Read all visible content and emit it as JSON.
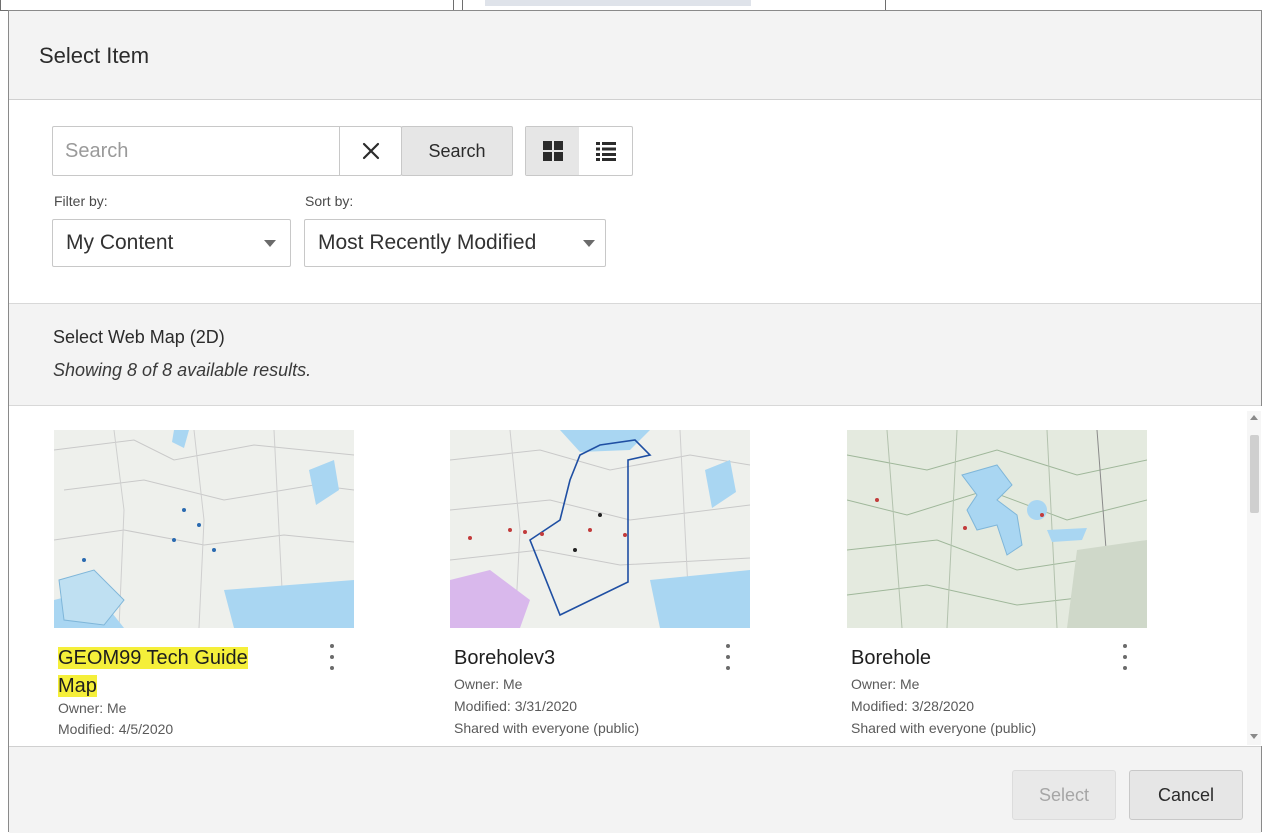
{
  "dialog": {
    "title": "Select Item"
  },
  "toolbar": {
    "search_placeholder": "Search",
    "search_value": "",
    "search_button": "Search",
    "view_mode": "grid"
  },
  "filters": {
    "filter_label": "Filter by:",
    "filter_value": "My Content",
    "sort_label": "Sort by:",
    "sort_value": "Most Recently Modified"
  },
  "section": {
    "title": "Select Web Map (2D)",
    "subtitle": "Showing 8 of 8 available results."
  },
  "items": [
    {
      "title_line1": "GEOM99 Tech Guide",
      "title_line2": "Map",
      "owner": "Owner: Me",
      "modified": "Modified: 4/5/2020",
      "shared": ""
    },
    {
      "title_line1": "Boreholev3",
      "title_line2": "",
      "owner": "Owner: Me",
      "modified": "Modified: 3/31/2020",
      "shared": "Shared with everyone (public)"
    },
    {
      "title_line1": "Borehole",
      "title_line2": "",
      "owner": "Owner: Me",
      "modified": "Modified: 3/28/2020",
      "shared": "Shared with everyone (public)"
    }
  ],
  "footer": {
    "select_label": "Select",
    "cancel_label": "Cancel"
  },
  "colors": {
    "highlight": "#f5ef3a",
    "header_bg": "#f3f3f3",
    "water": "#a9d6f2",
    "boundary": "#1f4fa3"
  }
}
